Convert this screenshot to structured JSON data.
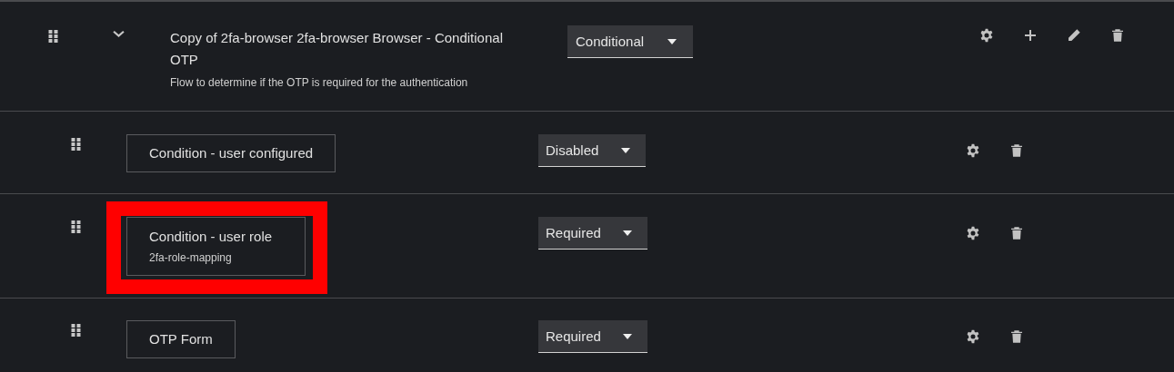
{
  "flow": {
    "title": "Copy of 2fa-browser 2fa-browser Browser - Conditional OTP",
    "description": "Flow to determine if the OTP is required for the authentication",
    "expanded": true,
    "requirement": "Conditional",
    "actions": [
      {
        "kind": "settings"
      },
      {
        "kind": "add"
      },
      {
        "kind": "edit"
      },
      {
        "kind": "delete"
      }
    ]
  },
  "steps": [
    {
      "name": "Condition - user configured",
      "requirement": "Disabled",
      "highlighted": false,
      "actions": [
        {
          "kind": "settings"
        },
        {
          "kind": "delete"
        }
      ]
    },
    {
      "name": "Condition - user role",
      "alias": "2fa-role-mapping",
      "requirement": "Required",
      "highlighted": true,
      "actions": [
        {
          "kind": "settings"
        },
        {
          "kind": "delete"
        }
      ]
    },
    {
      "name": "OTP Form",
      "requirement": "Required",
      "highlighted": false,
      "actions": [
        {
          "kind": "settings"
        },
        {
          "kind": "delete"
        }
      ]
    }
  ]
}
